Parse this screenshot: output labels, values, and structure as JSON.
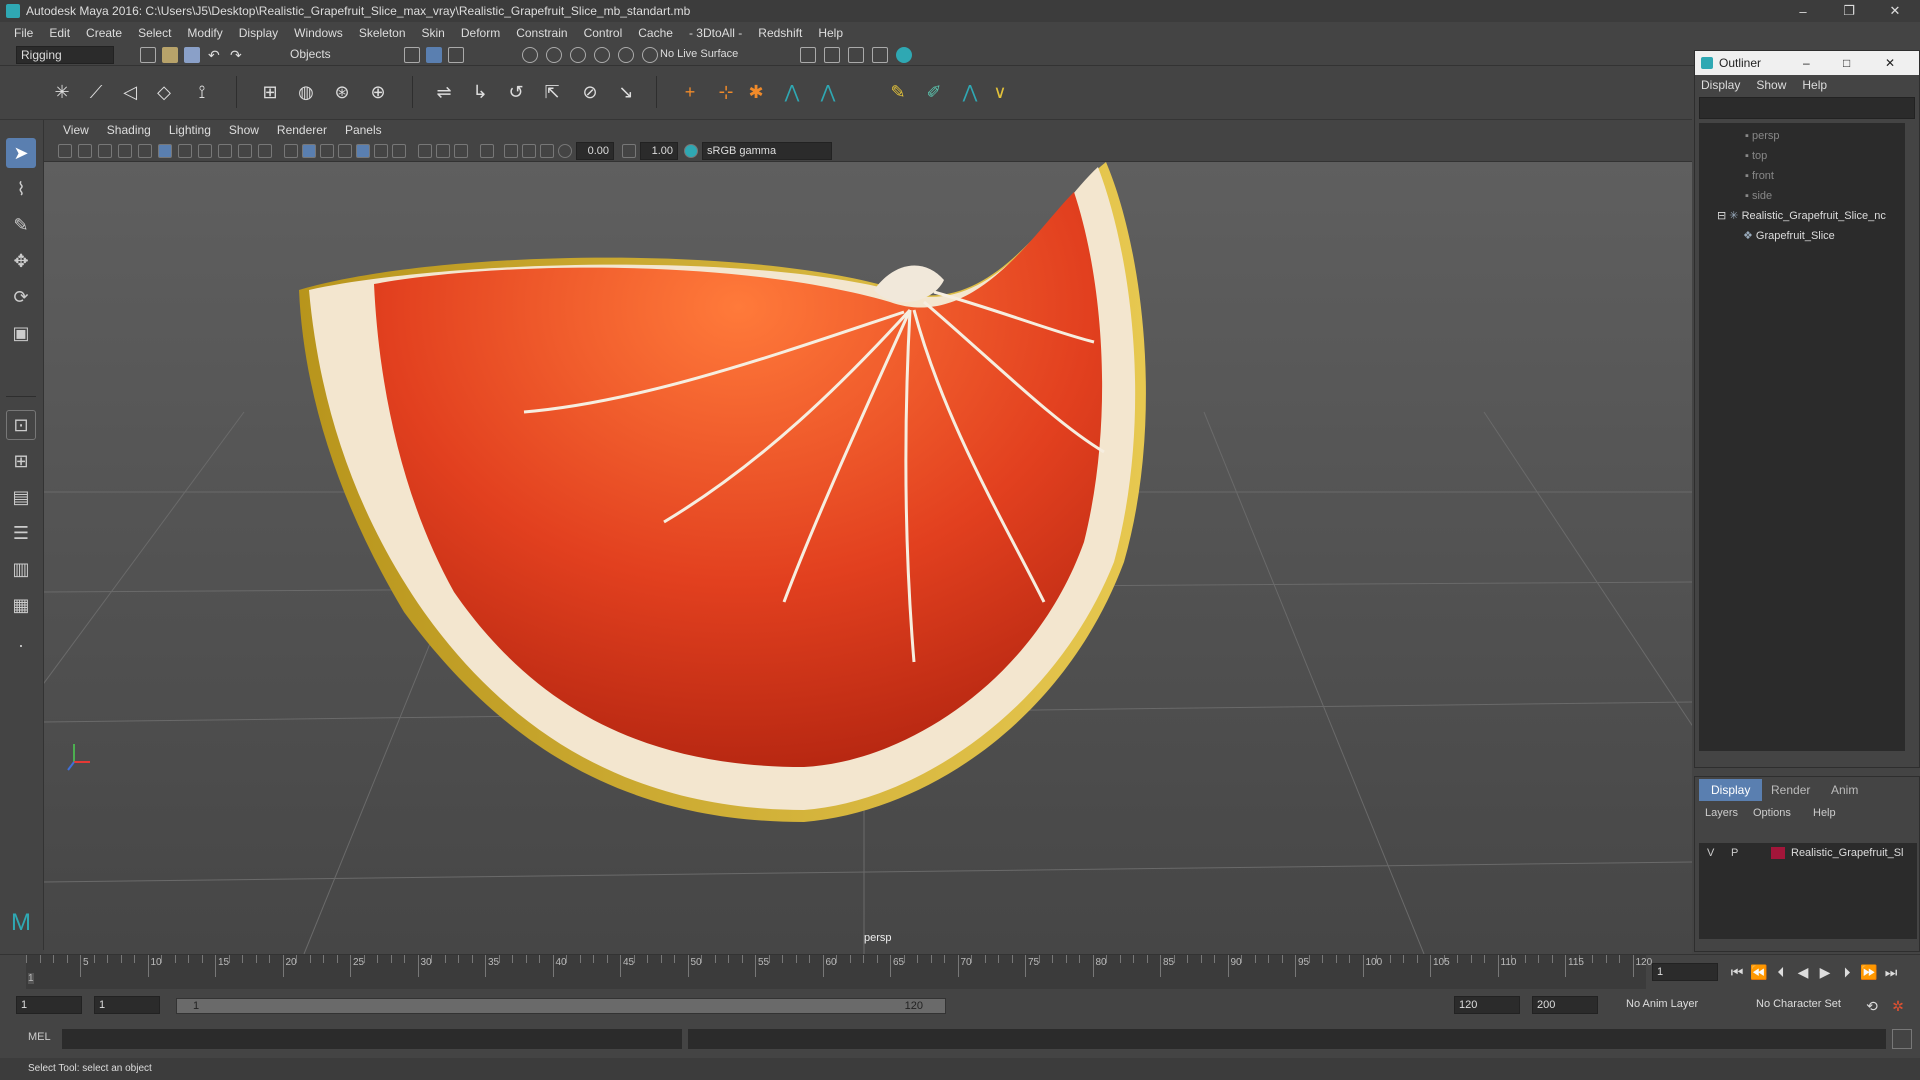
{
  "window": {
    "title": "Autodesk Maya 2016: C:\\Users\\J5\\Desktop\\Realistic_Grapefruit_Slice_max_vray\\Realistic_Grapefruit_Slice_mb_standart.mb",
    "minimize": "–",
    "maximize": "❐",
    "close": "✕"
  },
  "menu": [
    "File",
    "Edit",
    "Create",
    "Select",
    "Modify",
    "Display",
    "Windows",
    "Skeleton",
    "Skin",
    "Deform",
    "Constrain",
    "Control",
    "Cache",
    "- 3DtoAll -",
    "Redshift",
    "Help"
  ],
  "status": {
    "mode": "Rigging",
    "selection": "Objects",
    "live_surface": "No Live Surface"
  },
  "viewport": {
    "menu": [
      "View",
      "Shading",
      "Lighting",
      "Show",
      "Renderer",
      "Panels"
    ],
    "exposure": "0.00",
    "gamma": "1.00",
    "colorspace": "sRGB gamma",
    "camera_label": "persp"
  },
  "outliner": {
    "title": "Outliner",
    "menu": [
      "Display",
      "Show",
      "Help"
    ],
    "items": [
      "persp",
      "top",
      "front",
      "side",
      "Realistic_Grapefruit_Slice_nc",
      "Grapefruit_Slice"
    ]
  },
  "layers": {
    "tabs": [
      "Display",
      "Render",
      "Anim"
    ],
    "menu": [
      "Layers",
      "Options",
      "Help"
    ],
    "row": {
      "v": "V",
      "p": "P",
      "name": "Realistic_Grapefruit_Sl",
      "color": "#a3163a"
    }
  },
  "timeline": {
    "ticks": [
      "5",
      "10",
      "15",
      "20",
      "25",
      "30",
      "35",
      "40",
      "45",
      "50",
      "55",
      "60",
      "65",
      "70",
      "75",
      "80",
      "85",
      "90",
      "95",
      "100",
      "105",
      "110",
      "115",
      "120"
    ],
    "start_marker": "1",
    "current_frame": "1"
  },
  "range": {
    "start": "1",
    "playback_start": "1",
    "slider_start": "1",
    "slider_end": "120",
    "playback_end": "120",
    "end": "200",
    "anim_layer": "No Anim Layer",
    "character_set": "No Character Set"
  },
  "command": {
    "label": "MEL"
  },
  "help_line": "Select Tool: select an object",
  "colors": {
    "accent": "#2fa8b3",
    "flesh": "#e0401e",
    "pith": "#f3e6cf",
    "rind": "#cfae2a"
  }
}
